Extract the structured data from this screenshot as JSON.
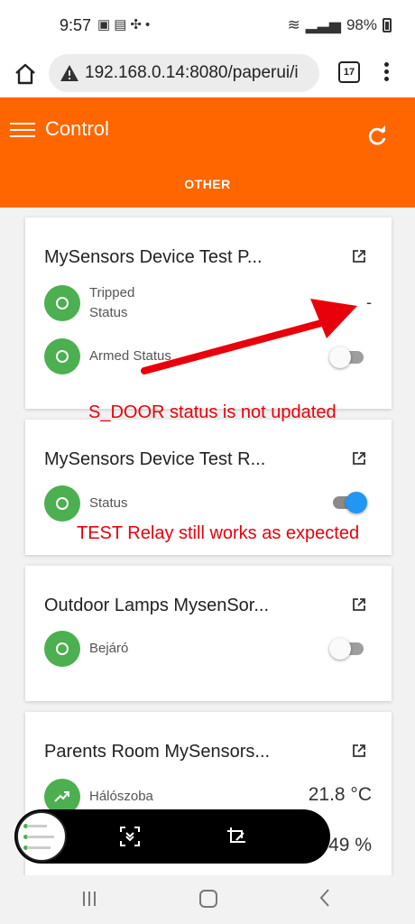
{
  "status_bar": {
    "time": "9:57",
    "notification_icons": [
      "image-icon",
      "teams-icon",
      "pinwheel-icon",
      "dot-icon"
    ],
    "battery": "98%"
  },
  "browser": {
    "url": "192.168.0.14:8080/paperui/i",
    "tab_count": "17"
  },
  "app": {
    "title": "Control",
    "tab": "OTHER"
  },
  "cards": [
    {
      "title": "MySensors Device Test P...",
      "items": [
        {
          "label": "Tripped Status",
          "value": "-"
        },
        {
          "label": "Armed Status",
          "toggle": false
        }
      ]
    },
    {
      "title": "MySensors Device Test R...",
      "items": [
        {
          "label": "Status",
          "toggle": true
        }
      ]
    },
    {
      "title": "Outdoor Lamps MysenSor...",
      "items": [
        {
          "label": "Bejáró",
          "toggle": false
        }
      ]
    },
    {
      "title": "Parents Room MySensors...",
      "items": [
        {
          "label": "Hálószoba",
          "value": "21.8 °C"
        },
        {
          "label": "",
          "value": "49 %"
        }
      ]
    }
  ],
  "annotations": [
    "S_DOOR status is not updated",
    "TEST Relay still works as expected"
  ],
  "colors": {
    "header": "#ff6600",
    "item_icon": "#4caf50",
    "toggle_on": "#2196f3",
    "annotation": "#e8000b"
  }
}
